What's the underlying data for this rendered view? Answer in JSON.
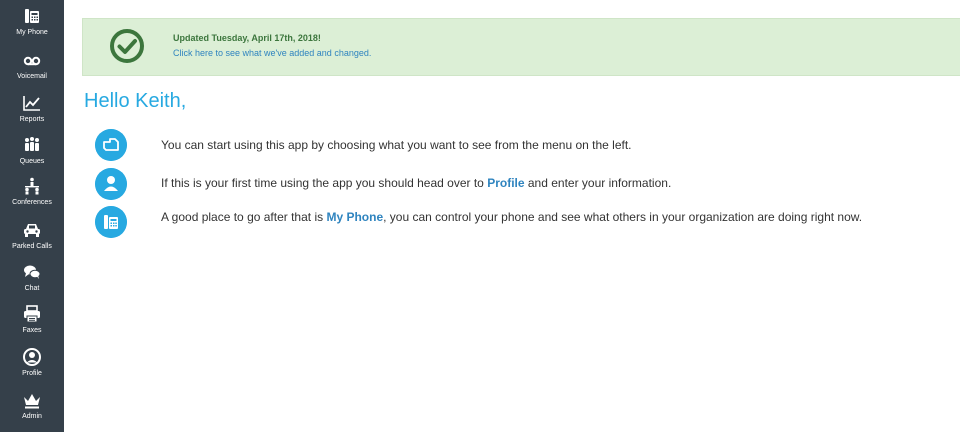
{
  "sidebar": {
    "items": [
      {
        "label": "My Phone",
        "icon": "phone-icon"
      },
      {
        "label": "Voicemail",
        "icon": "voicemail-icon"
      },
      {
        "label": "Reports",
        "icon": "chart-line-icon"
      },
      {
        "label": "Queues",
        "icon": "people-queue-icon"
      },
      {
        "label": "Conferences",
        "icon": "conference-icon"
      },
      {
        "label": "Parked Calls",
        "icon": "car-icon"
      },
      {
        "label": "Chat",
        "icon": "chat-bubbles-icon"
      },
      {
        "label": "Faxes",
        "icon": "printer-icon"
      },
      {
        "label": "Profile",
        "icon": "user-circle-icon"
      },
      {
        "label": "Admin",
        "icon": "crown-icon"
      }
    ]
  },
  "banner": {
    "title": "Updated Tuesday, April 17th, 2018!",
    "link": "Click here to see what we've added and changed."
  },
  "greeting": "Hello Keith,",
  "tips": {
    "menu": "You can start using this app by choosing what you want to see from the menu on the left.",
    "profile_before": "If this is your first time using the app you should head over to ",
    "profile_link": "Profile",
    "profile_after": " and enter your information.",
    "phone_before": "A good place to go after that is ",
    "phone_link": "My Phone",
    "phone_after": ", you can control your phone and see what others in your organization are doing right now."
  },
  "colors": {
    "sidebar_bg": "#35404a",
    "banner_bg": "#dcefd6",
    "banner_check": "#3c763d",
    "accent": "#27a9e1",
    "link": "#2f84bf"
  }
}
